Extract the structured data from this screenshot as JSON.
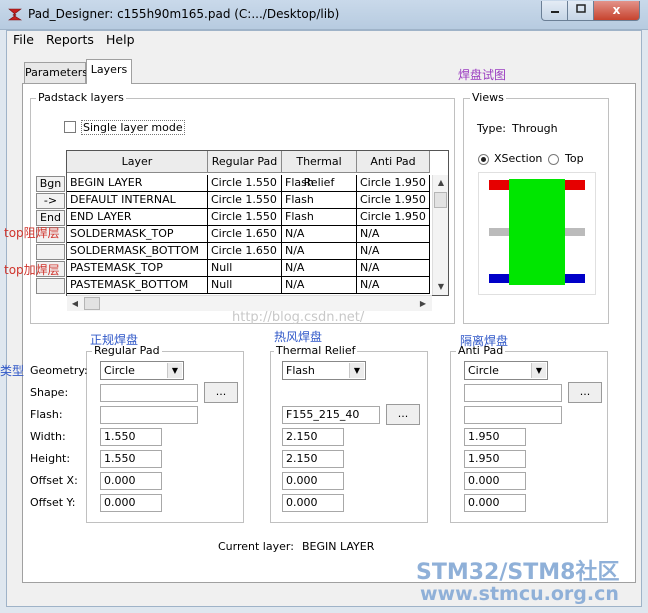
{
  "window": {
    "title": "Pad_Designer: c155h90m165.pad (C:.../Desktop/lib)",
    "close_glyph": "x"
  },
  "menu": [
    "File",
    "Reports",
    "Help"
  ],
  "tabs": [
    "Parameters",
    "Layers"
  ],
  "padstack": {
    "group_label": "Padstack layers",
    "single_layer_label": "Single layer mode",
    "columns": [
      "Layer",
      "Regular Pad",
      "Thermal Relief",
      "Anti Pad"
    ],
    "rows": [
      [
        "BEGIN LAYER",
        "Circle 1.550",
        "Flash",
        "Circle 1.950"
      ],
      [
        "DEFAULT INTERNAL",
        "Circle 1.550",
        "Flash",
        "Circle 1.950"
      ],
      [
        "END LAYER",
        "Circle 1.550",
        "Flash",
        "Circle 1.950"
      ],
      [
        "SOLDERMASK_TOP",
        "Circle 1.650",
        "N/A",
        "N/A"
      ],
      [
        "SOLDERMASK_BOTTOM",
        "Circle 1.650",
        "N/A",
        "N/A"
      ],
      [
        "PASTEMASK_TOP",
        "Null",
        "N/A",
        "N/A"
      ],
      [
        "PASTEMASK_BOTTOM",
        "Null",
        "N/A",
        "N/A"
      ]
    ],
    "side_buttons": [
      "Bgn",
      "->",
      "End"
    ]
  },
  "views": {
    "group_label": "Views",
    "type_label": "Type:",
    "type_value": "Through",
    "xsection_label": "XSection",
    "top_label": "Top",
    "selected": "XSection",
    "colors": {
      "pad_top": "#e60000",
      "body": "#00e600",
      "internal": "#bbbbbb",
      "pad_bottom": "#0000c8"
    }
  },
  "row_labels": [
    "Geometry:",
    "Shape:",
    "Flash:",
    "Width:",
    "Height:",
    "Offset X:",
    "Offset Y:"
  ],
  "regular_pad": {
    "group_label": "Regular Pad",
    "geometry": "Circle",
    "shape": "",
    "flash": "",
    "width": "1.550",
    "height": "1.550",
    "offset_x": "0.000",
    "offset_y": "0.000"
  },
  "thermal_relief": {
    "group_label": "Thermal Relief",
    "geometry": "Flash",
    "flash": "F155_215_40",
    "width": "2.150",
    "height": "2.150",
    "offset_x": "0.000",
    "offset_y": "0.000"
  },
  "anti_pad": {
    "group_label": "Anti Pad",
    "geometry": "Circle",
    "shape": "",
    "flash": "",
    "width": "1.950",
    "height": "1.950",
    "offset_x": "0.000",
    "offset_y": "0.000"
  },
  "browse_label": "...",
  "current_layer": {
    "label": "Current layer:",
    "value": "BEGIN LAYER"
  },
  "annotations": {
    "pad_preview": "焊盘试图",
    "top_solder": "top阻焊层",
    "top_paste": "top加焊层",
    "regular": "正规焊盘",
    "thermal": "热风焊盘",
    "anti": "隔离焊盘",
    "type": "类型"
  },
  "watermarks": {
    "blog": "http://blog.csdn.net/",
    "brand": "STM32/STM8社区",
    "url": "www.stmcu.org.cn"
  }
}
